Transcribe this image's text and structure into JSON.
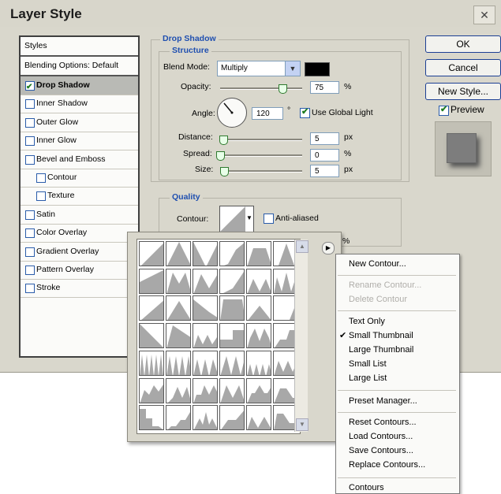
{
  "dialog": {
    "title": "Layer Style",
    "close_label": "✕"
  },
  "styles_list": {
    "header": "Styles",
    "blending": "Blending Options: Default",
    "items": [
      {
        "label": "Drop Shadow",
        "checked": true,
        "selected": true
      },
      {
        "label": "Inner Shadow",
        "checked": false
      },
      {
        "label": "Outer Glow",
        "checked": false
      },
      {
        "label": "Inner Glow",
        "checked": false
      },
      {
        "label": "Bevel and Emboss",
        "checked": false
      },
      {
        "label": "Contour",
        "checked": false
      },
      {
        "label": "Texture",
        "checked": false
      },
      {
        "label": "Satin",
        "checked": false
      },
      {
        "label": "Color Overlay",
        "checked": false
      },
      {
        "label": "Gradient Overlay",
        "checked": false
      },
      {
        "label": "Pattern Overlay",
        "checked": false
      },
      {
        "label": "Stroke",
        "checked": false
      }
    ]
  },
  "drop_shadow": {
    "title": "Drop Shadow",
    "structure_title": "Structure",
    "blend_mode_label": "Blend Mode:",
    "blend_mode_value": "Multiply",
    "blend_color": "#000000",
    "opacity_label": "Opacity:",
    "opacity_value": "75",
    "opacity_level": 0.75,
    "opacity_unit": "%",
    "angle_label": "Angle:",
    "angle_value": "120",
    "angle_unit": "°",
    "use_global_light_label": "Use Global Light",
    "use_global_light_checked": true,
    "distance_label": "Distance:",
    "distance_value": "5",
    "distance_unit": "px",
    "spread_label": "Spread:",
    "spread_value": "0",
    "spread_unit": "%",
    "size_label": "Size:",
    "size_value": "5",
    "size_unit": "px"
  },
  "quality": {
    "title": "Quality",
    "contour_label": "Contour:",
    "anti_aliased_label": "Anti-aliased",
    "anti_aliased_checked": false,
    "noise_unit": "%"
  },
  "buttons": {
    "ok": "OK",
    "cancel": "Cancel",
    "new_style": "New Style...",
    "preview": "Preview",
    "preview_checked": true
  },
  "contour_menu": {
    "arrow_icon": "▶",
    "items": [
      {
        "label": "New Contour...",
        "disabled": false
      },
      {
        "label": "Rename Contour...",
        "disabled": true
      },
      {
        "label": "Delete Contour",
        "disabled": true
      },
      {
        "label": "Text Only",
        "disabled": false
      },
      {
        "label": "Small Thumbnail",
        "disabled": false,
        "checked": true
      },
      {
        "label": "Large Thumbnail",
        "disabled": false
      },
      {
        "label": "Small List",
        "disabled": false
      },
      {
        "label": "Large List",
        "disabled": false
      },
      {
        "label": "Preset Manager...",
        "disabled": false
      },
      {
        "label": "Reset Contours...",
        "disabled": false
      },
      {
        "label": "Load Contours...",
        "disabled": false
      },
      {
        "label": "Save Contours...",
        "disabled": false
      },
      {
        "label": "Replace Contours...",
        "disabled": false
      },
      {
        "label": "Contours",
        "disabled": false
      }
    ]
  },
  "colors": {
    "dialog_bg": "#d9d7cc",
    "accent_blue": "#1f4fb0",
    "contour_fill": "#a8a8a8"
  }
}
